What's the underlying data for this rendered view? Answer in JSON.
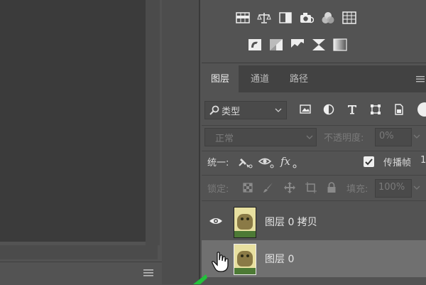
{
  "tabs": [
    {
      "label": "图层",
      "active": true
    },
    {
      "label": "通道",
      "active": false
    },
    {
      "label": "路径",
      "active": false
    }
  ],
  "filter": {
    "search_icon": "search-icon",
    "kind_label": "类型",
    "kind_icons": [
      "image-filter-icon",
      "adjustment-filter-icon",
      "type-filter-icon",
      "shape-filter-icon",
      "smart-object-filter-icon"
    ]
  },
  "blend": {
    "mode": "正常",
    "opacity_label": "不透明度:",
    "opacity_value": "0%"
  },
  "unify": {
    "label": "统一:",
    "propagate_label": "传播帧",
    "propagate_extra": "1",
    "propagate_checked": true
  },
  "lock": {
    "label": "锁定:",
    "fill_label": "填充:",
    "fill_value": "100%"
  },
  "layers": [
    {
      "name": "图层 0 拷贝",
      "visible": true,
      "selected": false
    },
    {
      "name": "图层 0",
      "visible": false,
      "selected": true
    }
  ],
  "colors": {
    "panel": "#535353",
    "tabbar": "#424242",
    "selected_row": "#707070",
    "canvas": "#3b3b3b"
  }
}
